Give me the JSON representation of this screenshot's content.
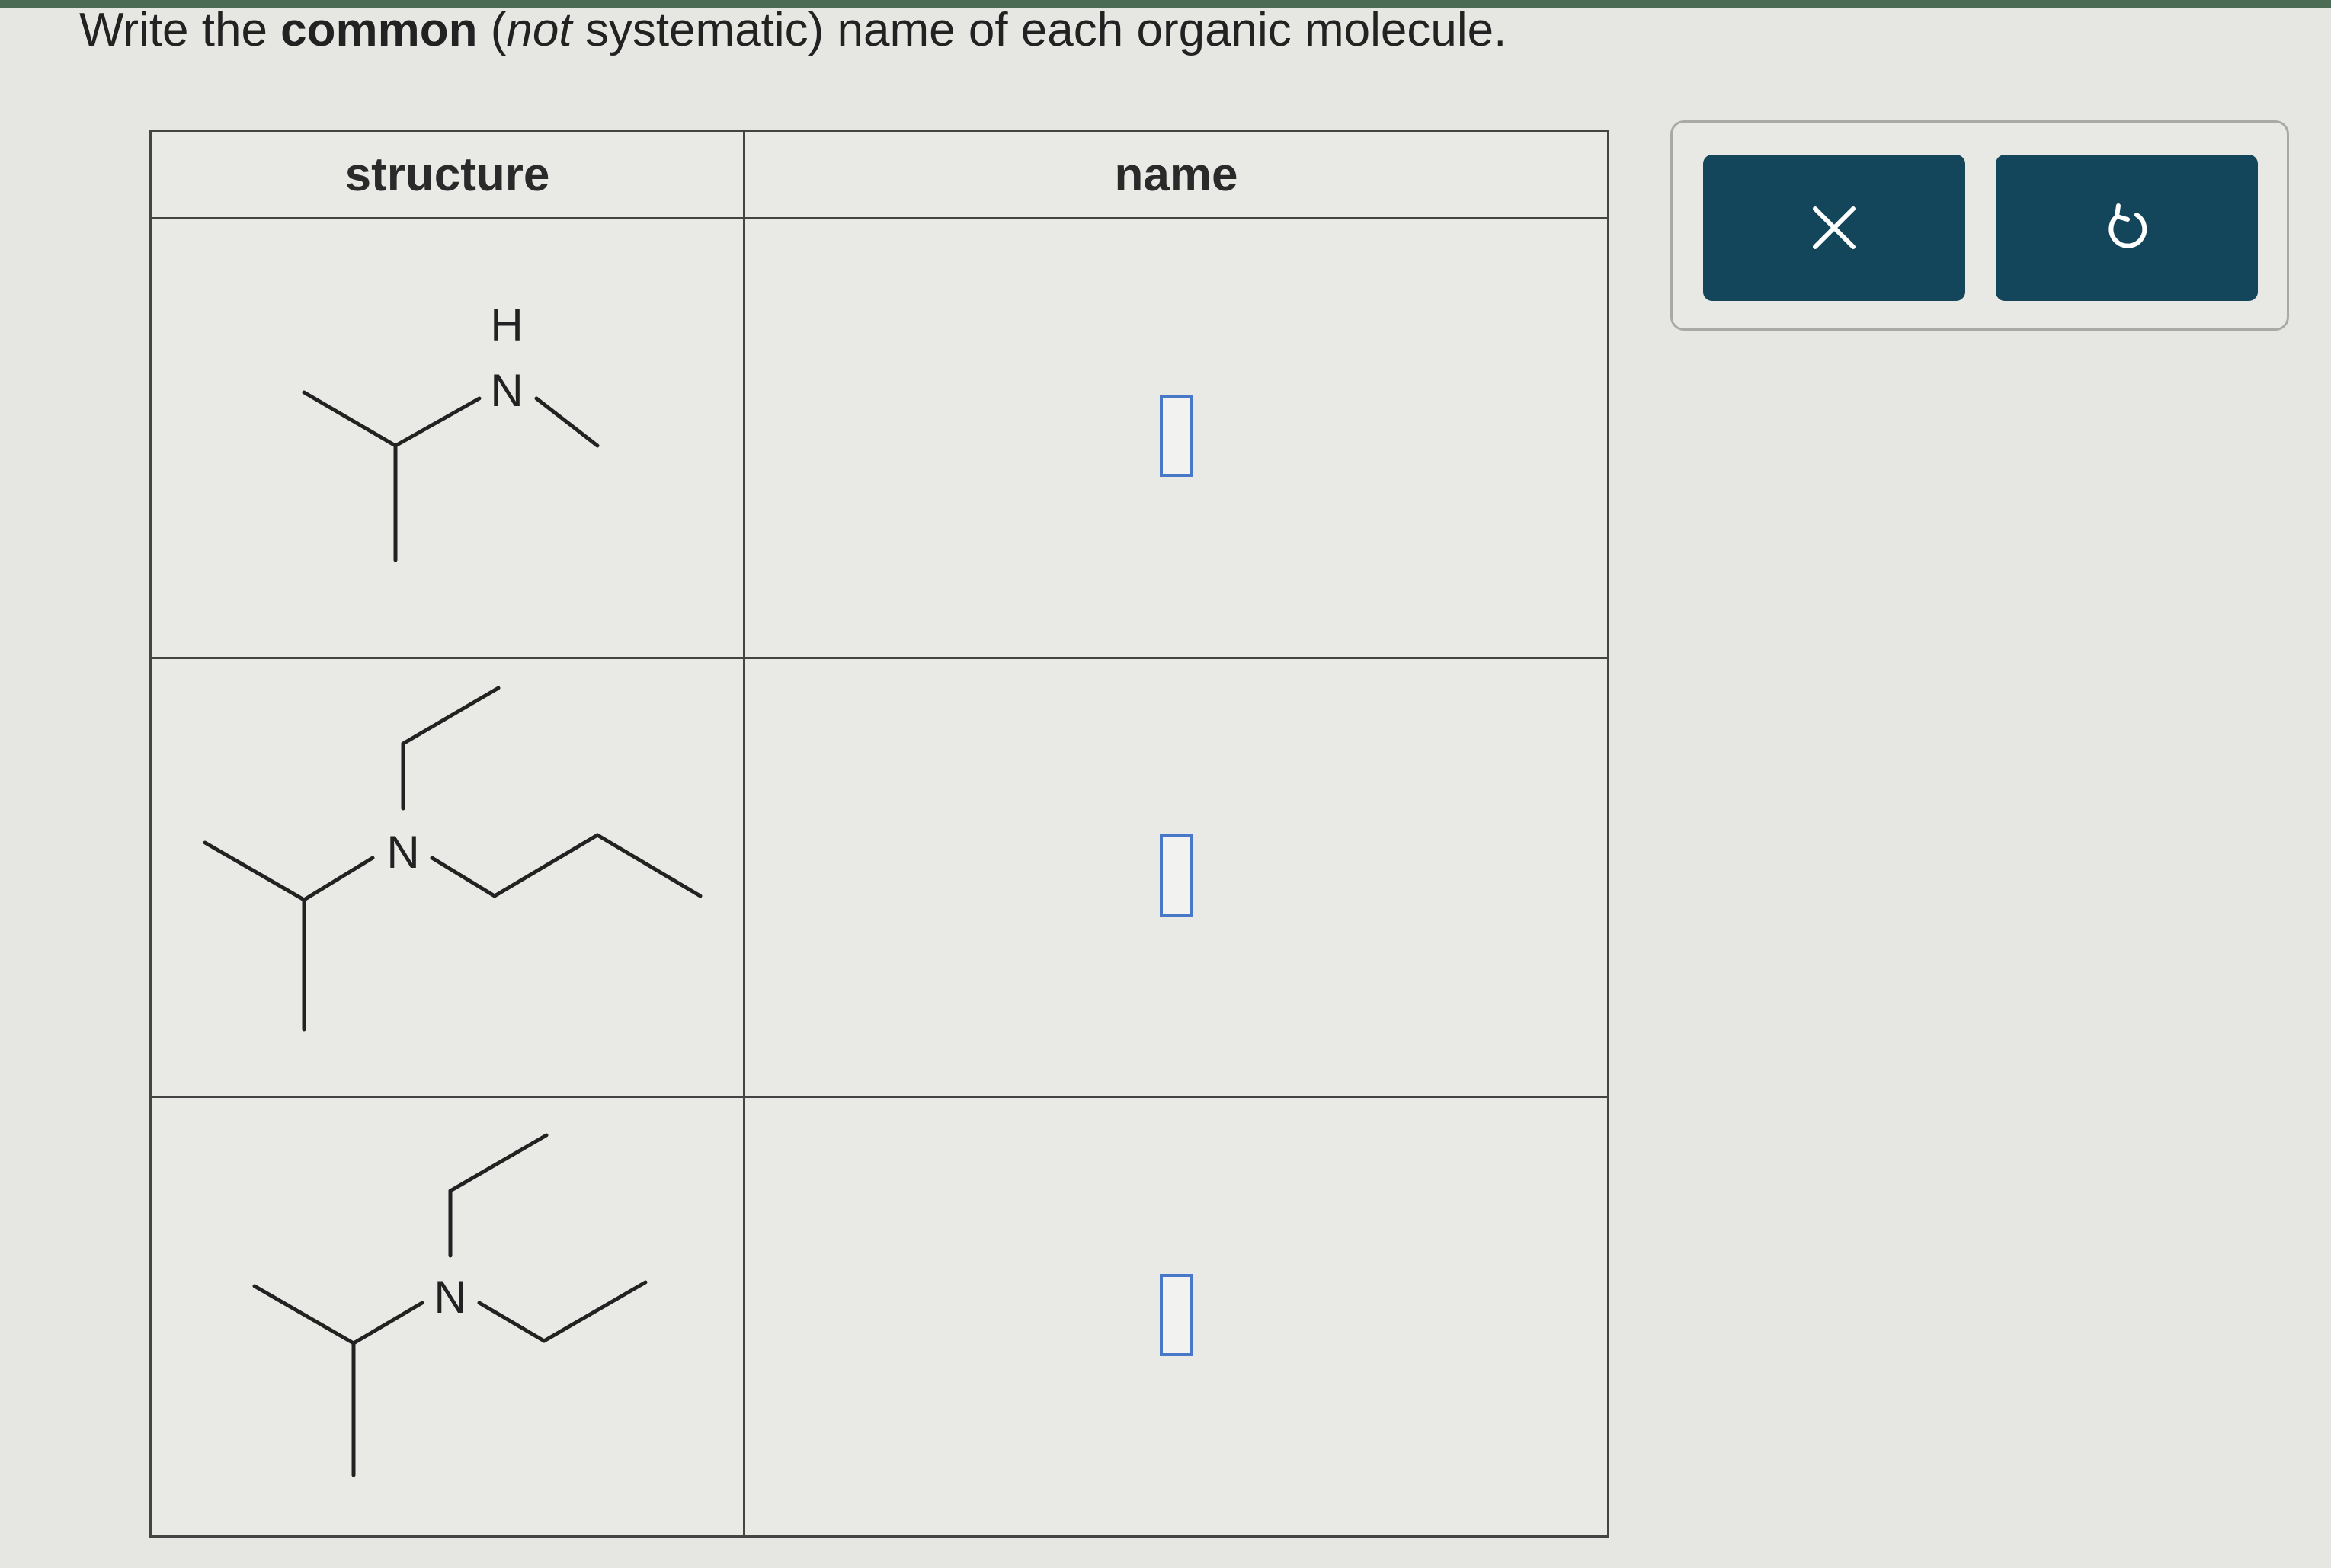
{
  "instruction": {
    "prefix": "Write the ",
    "bold": "common",
    "mid1": " (",
    "italic": "not",
    "suffix": " systematic) name of each organic molecule."
  },
  "table": {
    "headers": [
      "structure",
      "name"
    ],
    "rows": [
      {
        "atom_label_h": "H",
        "atom_label": "N",
        "name_value": ""
      },
      {
        "atom_label": "N",
        "name_value": ""
      },
      {
        "atom_label": "N",
        "name_value": ""
      }
    ]
  },
  "tools": {
    "clear_icon": "x-icon",
    "undo_icon": "undo-icon",
    "button_color": "#13465a"
  },
  "colors": {
    "answer_box_border": "#4a78c8"
  }
}
